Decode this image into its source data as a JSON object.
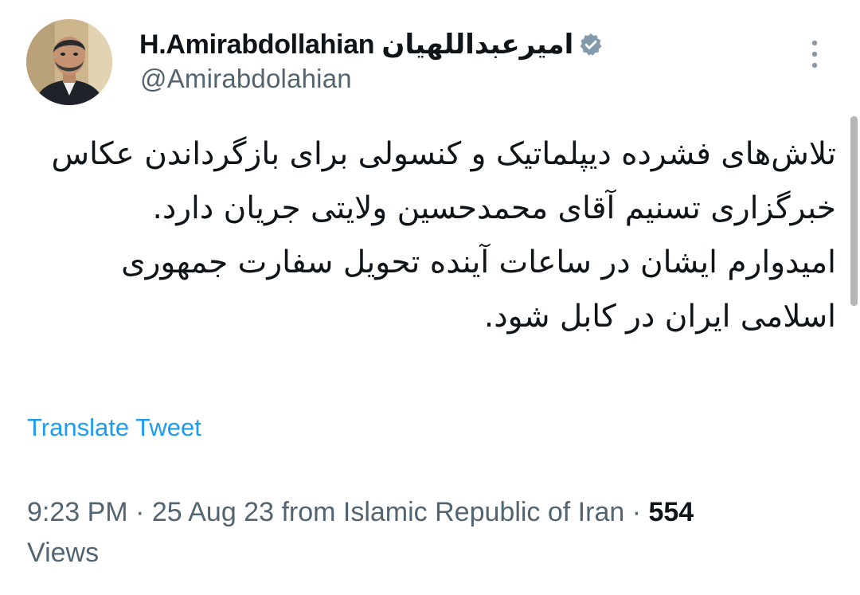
{
  "author": {
    "avatar_icon": "profile-photo",
    "display_name": "H.Amirabdollahian امیرعبداللهیان",
    "verified_icon": "verified-badge-icon",
    "handle": "@Amirabdolahian"
  },
  "menu": {
    "icon": "more-vertical-icon"
  },
  "tweet": {
    "paragraph_1": "تلاش‌های فشرده دیپلماتیک و کنسولی برای بازگرداندن عکاس خبرگزاری تسنیم آقای محمدحسین ولایتی جریان دارد.",
    "paragraph_2": "امیدوارم ایشان در ساعات آینده تحویل سفارت جمهوری اسلامی ایران در کابل شود."
  },
  "translate_label": "Translate Tweet",
  "meta": {
    "time": "9:23 PM",
    "separator": " · ",
    "date": "25 Aug 23",
    "location": "from Islamic Republic of Iran",
    "views_count": "554",
    "views_label": "Views"
  },
  "colors": {
    "text": "#0f1419",
    "secondary": "#536471",
    "link": "#1d9bf0",
    "verified": "#829aab"
  }
}
